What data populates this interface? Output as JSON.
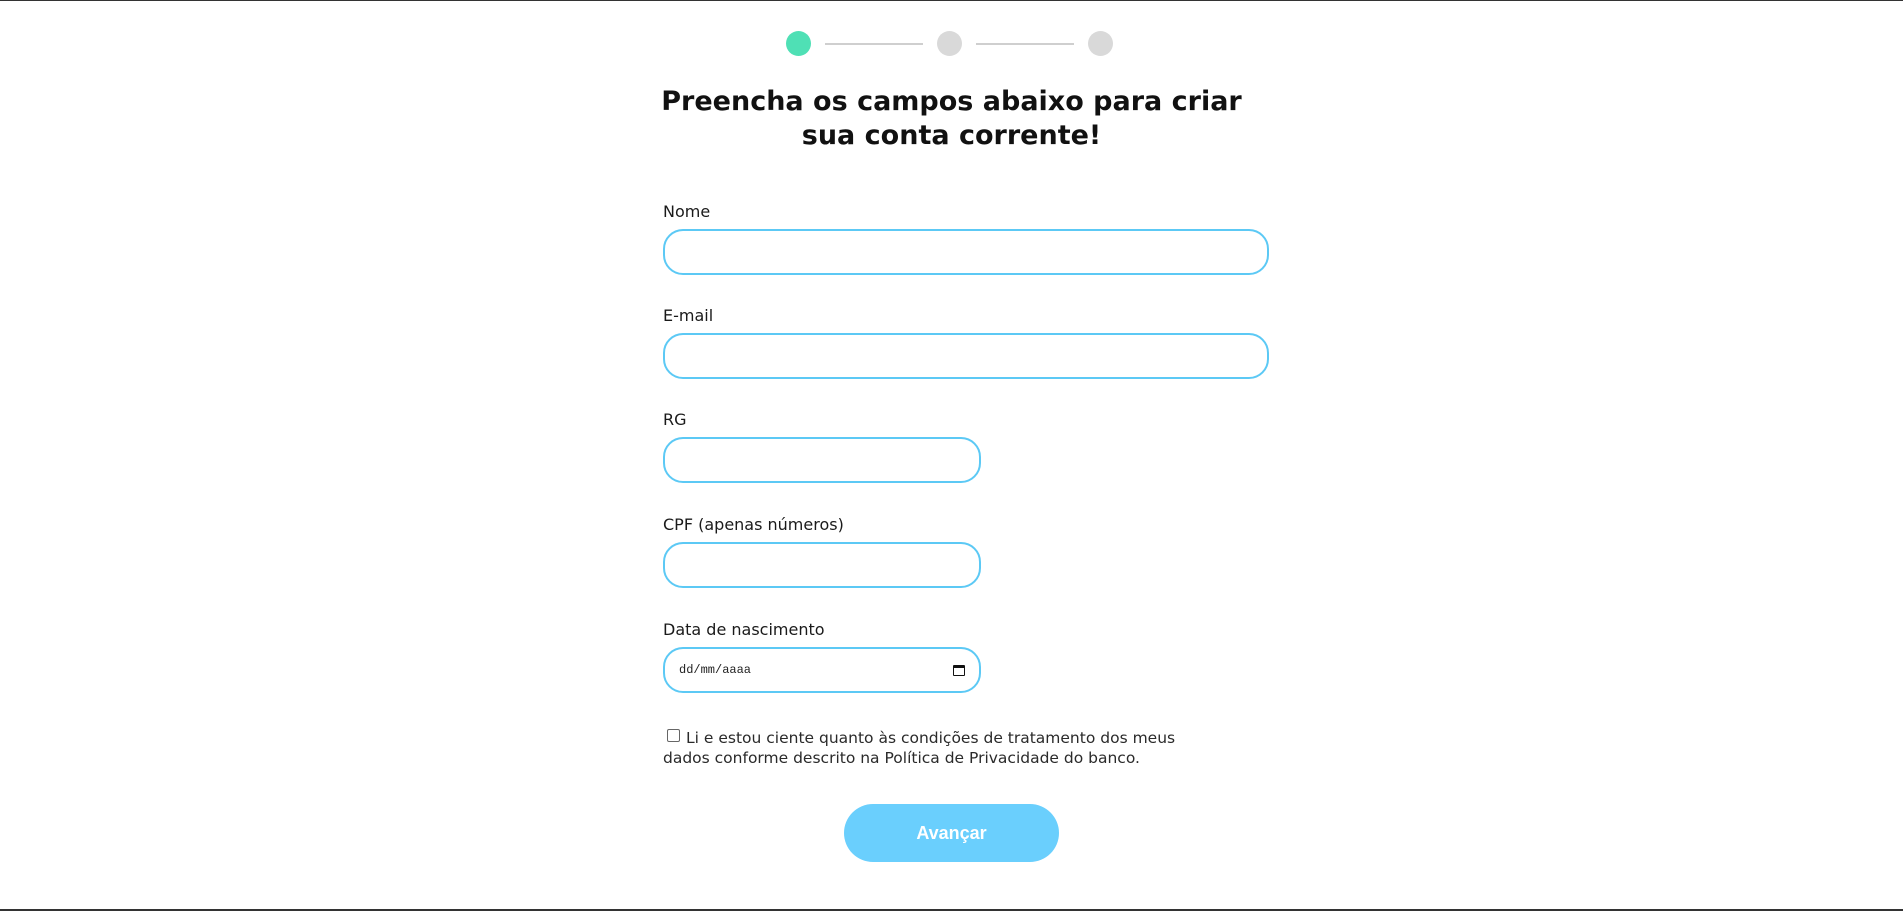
{
  "stepper": {
    "steps": [
      {
        "state": "active",
        "color": "#4fe0b5"
      },
      {
        "state": "inactive",
        "color": "#d9d9d9"
      },
      {
        "state": "inactive",
        "color": "#d9d9d9"
      }
    ],
    "current_step": 1,
    "total_steps": 3
  },
  "title": {
    "line1": "Preencha os campos abaixo para criar",
    "line2": "sua conta corrente!"
  },
  "form": {
    "nome": {
      "label": "Nome",
      "value": ""
    },
    "email": {
      "label": "E-mail",
      "value": ""
    },
    "rg": {
      "label": "RG",
      "value": ""
    },
    "cpf": {
      "label": "CPF (apenas números)",
      "value": ""
    },
    "nascimento": {
      "label": "Data de nascimento",
      "placeholder": "dd/mm/aaaa"
    }
  },
  "consent": {
    "checked": false,
    "text": "Li e estou ciente quanto às condições de tratamento dos meus dados conforme descrito na Política de Privacidade do banco."
  },
  "submit": {
    "label": "Avançar"
  },
  "colors": {
    "accent": "#5cc9f5",
    "button": "#6acffd",
    "step_active": "#4fe0b5"
  }
}
